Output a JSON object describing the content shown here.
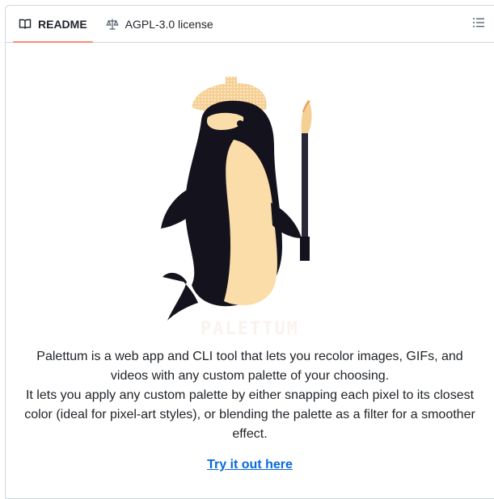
{
  "tabs": [
    {
      "label": "README",
      "icon": "book-icon",
      "active": true
    },
    {
      "label": "AGPL-3.0 license",
      "icon": "scale-icon",
      "active": false
    }
  ],
  "outline_icon": "list-unordered-icon",
  "readme": {
    "logo_wordmark": "Palettum",
    "description_line1": "Palettum is a web app and CLI tool that lets you recolor images, GIFs, and videos with any custom palette of your choosing.",
    "description_line2": "It lets you apply any custom palette by either snapping each pixel to its closest color (ideal for pixel-art styles), or blending the palette as a filter for a smoother effect.",
    "link_text": "Try it out here"
  },
  "colors": {
    "tab_underline": "#fd8c73",
    "link": "#0969da",
    "orca_body": "#14121c",
    "orca_belly": "#fbddaa",
    "beret": "#f7d39c"
  }
}
